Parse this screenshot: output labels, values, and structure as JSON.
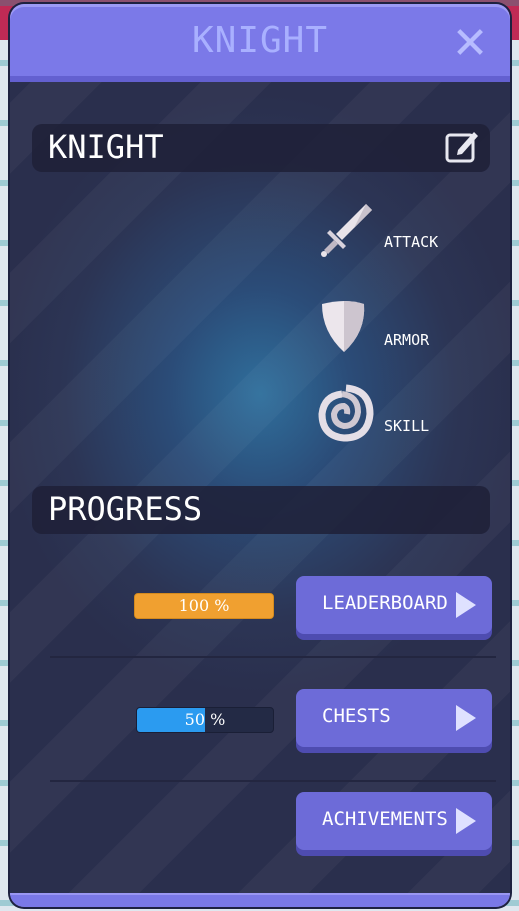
{
  "window": {
    "title": "KNIGHT",
    "close_icon": "close-icon"
  },
  "hero": {
    "name": "KNIGHT",
    "edit_icon": "edit-icon"
  },
  "stats": [
    {
      "icon": "sword-icon",
      "label": "ATTACK"
    },
    {
      "icon": "shield-icon",
      "label": "ARMOR"
    },
    {
      "icon": "spiral-icon",
      "label": "SKILL"
    }
  ],
  "progress_section": {
    "title": "PROGRESS"
  },
  "rows": [
    {
      "progress_text": "100 %",
      "progress_value": 1.0,
      "bar_color": "#f0a030",
      "button_label": "LEADERBOARD"
    },
    {
      "progress_text": "50 %",
      "progress_value": 0.5,
      "bar_color": "#2b9bf0",
      "button_label": "CHESTS"
    },
    {
      "button_label": "ACHIVEMENTS"
    }
  ],
  "colors": {
    "accent": "#7b79e8",
    "button": "#6d6bd8",
    "panel": "#2c3555"
  }
}
